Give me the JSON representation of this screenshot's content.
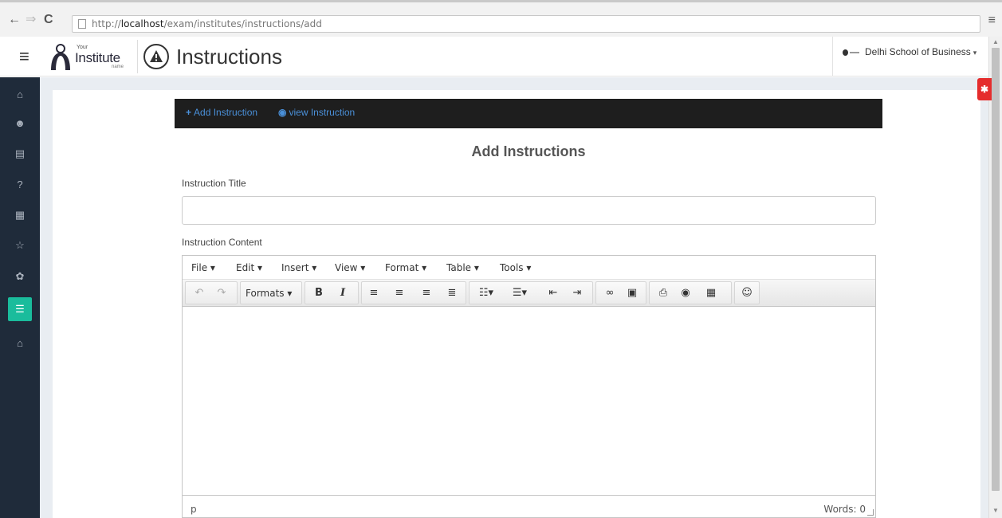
{
  "browser": {
    "back_icon": "←",
    "forward_icon": "⇒",
    "reload_icon": "C",
    "url_prefix": "http://",
    "url_host": "localhost",
    "url_path": "/exam/institutes/instructions/add",
    "menu_icon": "≡"
  },
  "header": {
    "logo_your": "Your",
    "logo_institute": "Institute",
    "logo_name": "name",
    "title": "Instructions",
    "school": "Delhi School of Business",
    "school_caret": "▾"
  },
  "sidebar": {
    "items": [
      {
        "icon": "home-icon",
        "glyph": "⌂"
      },
      {
        "icon": "users-icon",
        "glyph": "☻"
      },
      {
        "icon": "card-icon",
        "glyph": "▤"
      },
      {
        "icon": "question-icon",
        "glyph": "?"
      },
      {
        "icon": "document-icon",
        "glyph": "▦"
      },
      {
        "icon": "star-icon",
        "glyph": "☆"
      },
      {
        "icon": "gear-icon",
        "glyph": "✿"
      },
      {
        "icon": "list-icon",
        "glyph": "☰",
        "active": true
      },
      {
        "icon": "bank-icon",
        "glyph": "⌂"
      }
    ]
  },
  "tabs": {
    "add_icon": "+",
    "add_label": "Add Instruction",
    "view_icon": "◉",
    "view_label": "view Instruction"
  },
  "form": {
    "heading": "Add Instructions",
    "title_label": "Instruction Title",
    "title_value": "",
    "content_label": "Instruction Content"
  },
  "editor": {
    "menus": [
      "File ▾",
      "Edit ▾",
      "Insert ▾",
      "View ▾",
      "Format ▾",
      "Table ▾",
      "Tools ▾"
    ],
    "formats_label": "Formats ▾",
    "bold": "B",
    "italic": "I",
    "status_path": "p",
    "word_count": "Words: 0"
  },
  "bug_badge": "✱"
}
